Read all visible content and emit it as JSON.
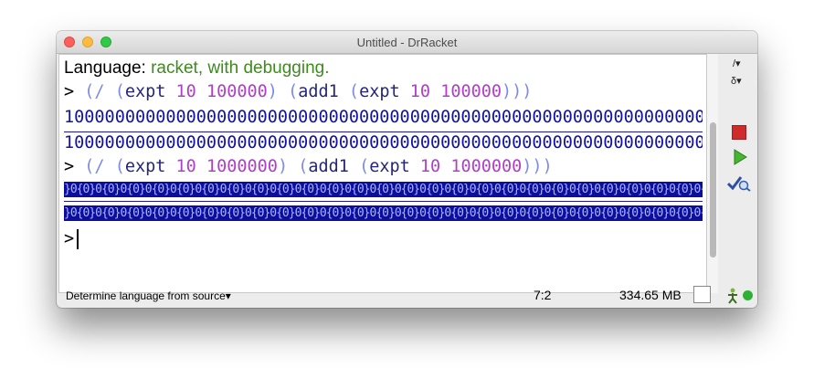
{
  "window": {
    "title": "Untitled - DrRacket"
  },
  "interactions": {
    "language_label": "Language: ",
    "language_value": "racket, with debugging.",
    "prompt": ">",
    "expr1": {
      "open_div": "(/",
      "open1": "(",
      "expt": "expt",
      "base": "10",
      "exp": "100000",
      "close1": ")",
      "open2": "(",
      "add1": "add1",
      "open3": "(",
      "expt2": "expt",
      "base2": "10",
      "exp2": "100000",
      "close_all": ")))"
    },
    "result1_a": "1000000000000000000000000000000000000000000000000000000000000000000000",
    "result1_b": "1000000000000000000000000000000000000000000000000000000000000000000000",
    "expr2": {
      "open_div": "(/",
      "open1": "(",
      "expt": "expt",
      "base": "10",
      "exp": "1000000",
      "close1": ")",
      "open2": "(",
      "add1": "add1",
      "open3": "(",
      "expt2": "expt",
      "base2": "10",
      "exp2": "1000000",
      "close_all": ")))"
    },
    "result2_a": "}0{0}0{0}0{0}0{0}0{0}0{0}0{0}0{0}0{0}0{0}0{0}0{0}0{0}0{0}0{0}0{0}0{0}0{0}0{0}0{0}0{0}0{0}0{0}0{0}0{0}0{0}0{0}0{0}0{0}0{0}0{0}0{0}0{0}0{0}0{0}0{0}0{0}0{0}0{0}0{0}0{0}0{0}0{0}0{0}0{0}",
    "result2_b": "}0{0}0{0}0{0}0{0}0{0}0{0}0{0}0{0}0{0}0{0}0{0}0{0}0{0}0{0}0{0}0{0}0{0}0{0}0{0}0{0}0{0}0{0}0{0}0{0}0{0}0{0}0{0}0{0}0{0}0{0}0{0}0{0}0{0}0{0}0{0}0{0}0{0}0{0}0{0}0{0}0{0}0{0}0{0}0{0}0{0}0{0}"
  },
  "sidebar": {
    "slash_btn": "/▾",
    "delta_btn": "δ▾"
  },
  "statusbar": {
    "language_menu": "Determine language from source▾",
    "position": "7:2",
    "memory": "334.65 MB"
  },
  "colors": {
    "language_value": "#3e8a1e",
    "paren": "#7d8ae8",
    "number": "#b13ec8",
    "result": "#1212a4",
    "status_dot": "#2eb035"
  },
  "icons": [
    "close-icon",
    "minimize-icon",
    "maximize-icon",
    "stop-icon",
    "run-icon",
    "check-syntax-icon",
    "gc-person-icon"
  ]
}
